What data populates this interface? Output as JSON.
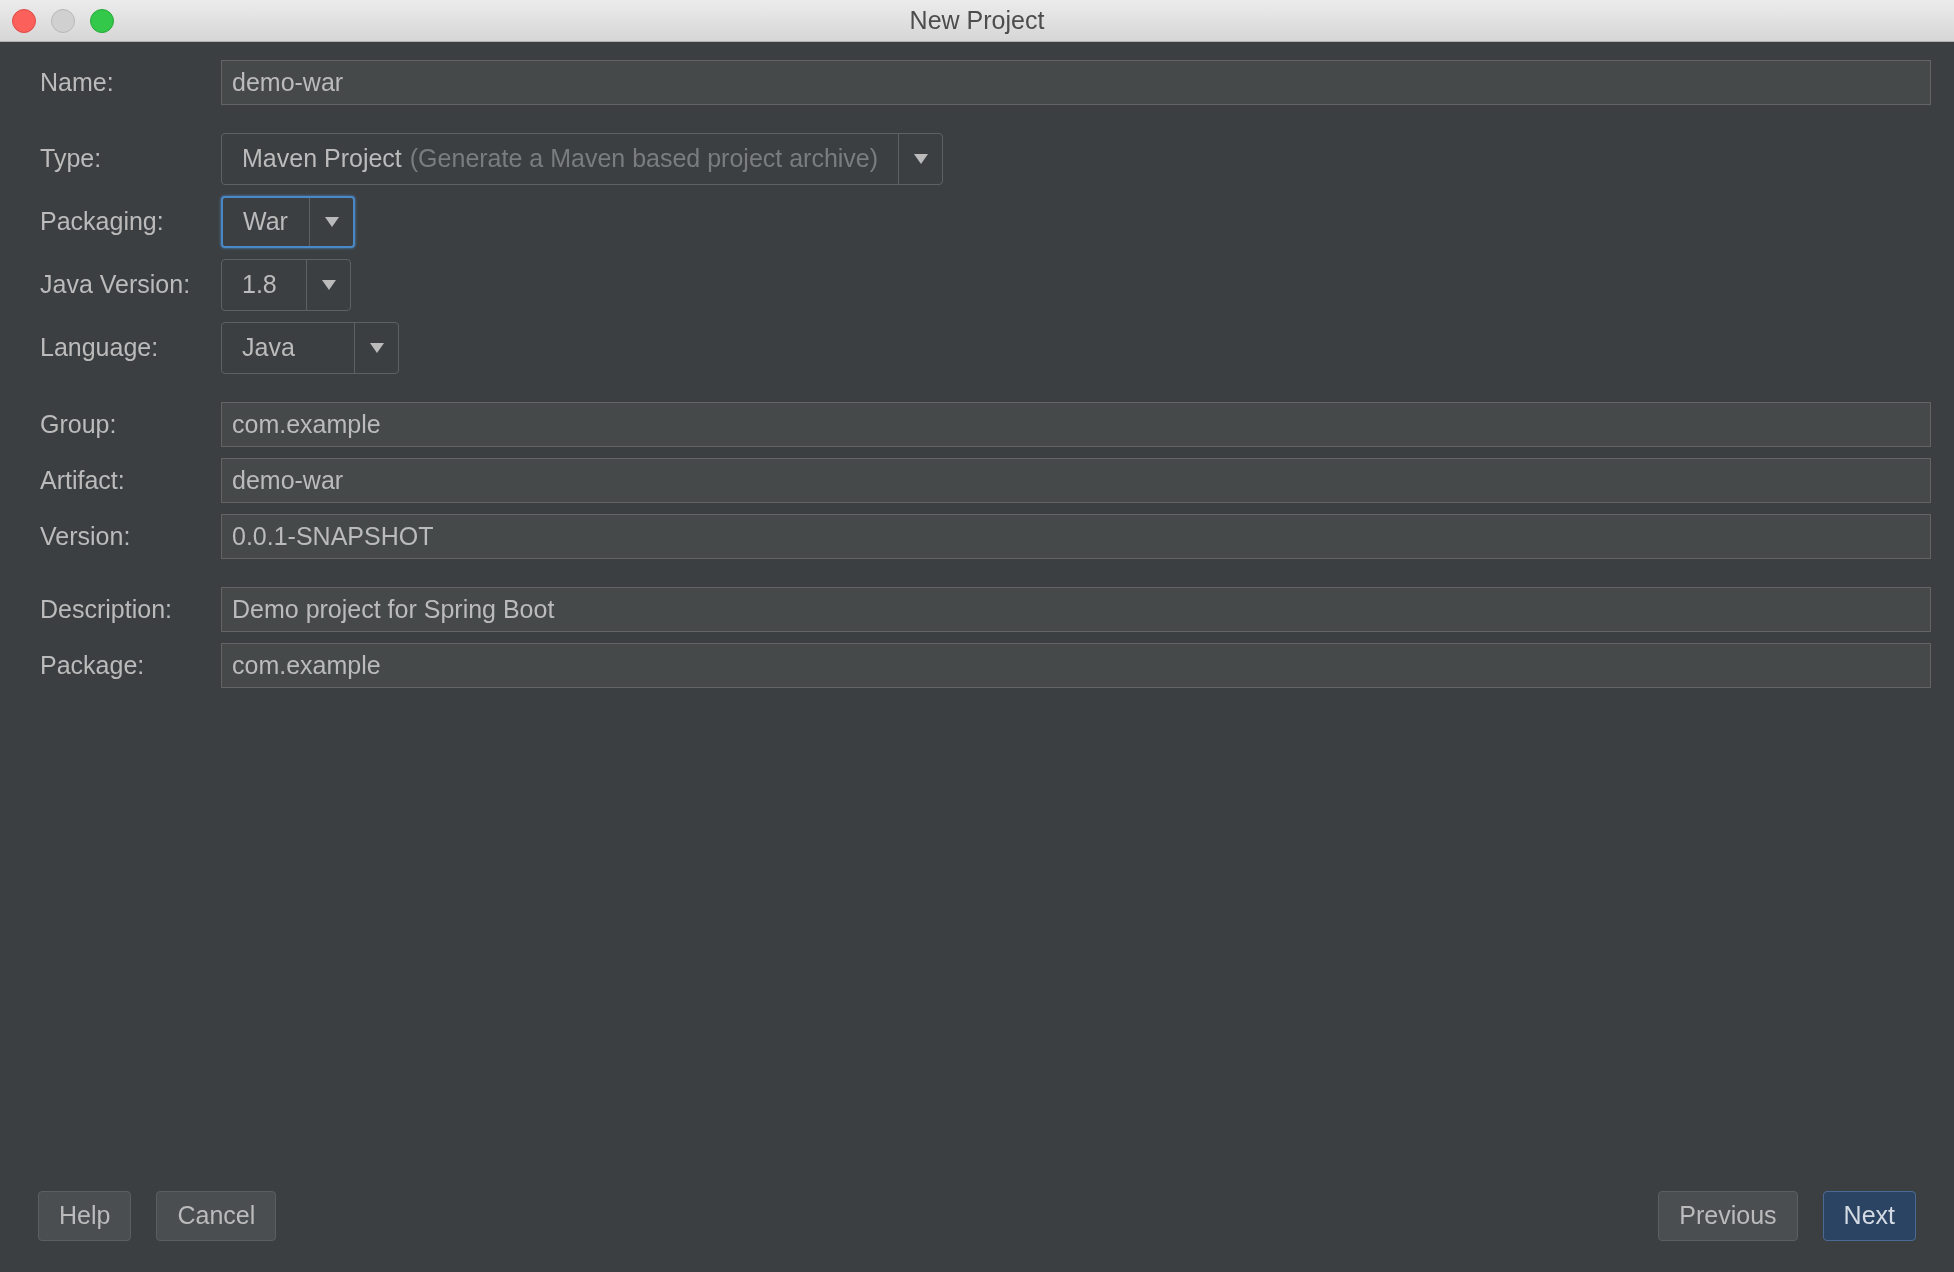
{
  "window": {
    "title": "New Project"
  },
  "sections": [
    {
      "fields": [
        {
          "kind": "text",
          "label": "Name:",
          "value": "demo-war"
        }
      ]
    },
    {
      "fields": [
        {
          "kind": "combo",
          "label": "Type:",
          "value": "Maven Project",
          "hint": "(Generate a Maven based project archive)",
          "focused": false
        },
        {
          "kind": "combo",
          "label": "Packaging:",
          "value": "War",
          "focused": true
        },
        {
          "kind": "combo",
          "label": "Java Version:",
          "value": "1.8",
          "focused": false
        },
        {
          "kind": "combo",
          "label": "Language:",
          "value": "Java",
          "focused": false
        }
      ]
    },
    {
      "fields": [
        {
          "kind": "text",
          "label": "Group:",
          "value": "com.example"
        },
        {
          "kind": "text",
          "label": "Artifact:",
          "value": "demo-war"
        },
        {
          "kind": "text",
          "label": "Version:",
          "value": "0.0.1-SNAPSHOT"
        }
      ]
    },
    {
      "fields": [
        {
          "kind": "text",
          "label": "Description:",
          "value": "Demo project for Spring Boot"
        },
        {
          "kind": "text",
          "label": "Package:",
          "value": "com.example"
        }
      ]
    }
  ],
  "buttons_left": [
    {
      "label": "Help",
      "default": false
    },
    {
      "label": "Cancel",
      "default": false
    }
  ],
  "buttons_right": [
    {
      "label": "Previous",
      "default": false
    },
    {
      "label": "Next",
      "default": true
    }
  ]
}
